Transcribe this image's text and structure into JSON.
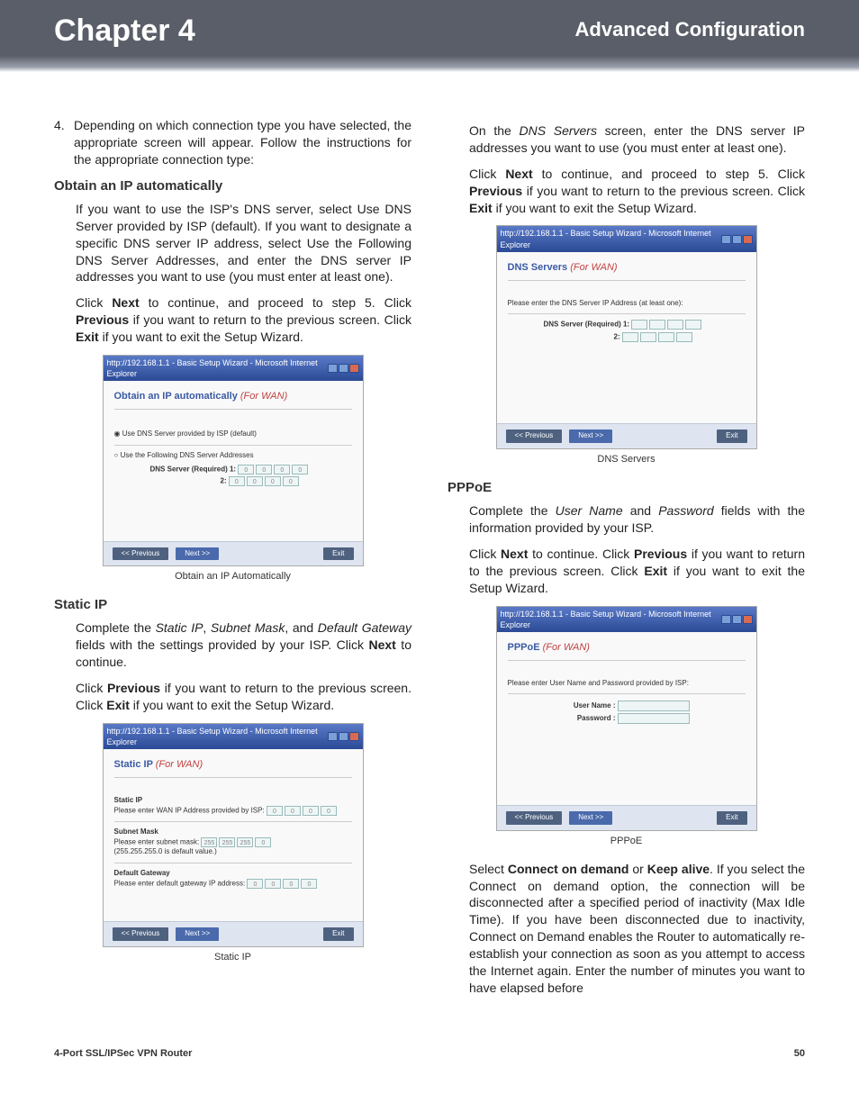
{
  "header": {
    "chapter": "Chapter 4",
    "section": "Advanced Configuration"
  },
  "footer": {
    "product": "4-Port SSL/IPSec VPN Router",
    "page": "50"
  },
  "left": {
    "step4_num": "4.",
    "step4": "Depending on which connection type you have selected, the appropriate screen will appear. Follow the instructions for the appropriate connection type:",
    "obtain_h": "Obtain an IP automatically",
    "obtain_p1": "If you want to use the ISP's DNS server, select Use DNS Server provided by ISP (default). If you want to designate a specific DNS server IP address, select Use the Following DNS Server Addresses, and enter the DNS server IP addresses you want to use (you must enter at least one).",
    "obtain_p2_a": "Click ",
    "obtain_p2_next": "Next",
    "obtain_p2_b": " to continue, and proceed to step 5. Click ",
    "obtain_p2_prev": "Previous",
    "obtain_p2_c": " if you want to return to the previous screen. Click ",
    "obtain_p2_exit": "Exit",
    "obtain_p2_d": " if you want to exit the Setup Wizard.",
    "shot1": {
      "title": "http://192.168.1.1 - Basic Setup Wizard - Microsoft Internet Explorer",
      "heading": "Obtain an IP automatically ",
      "heading_red": "(For WAN)",
      "opt1": "Use DNS Server provided by ISP (default)",
      "opt2": "Use the Following DNS Server Addresses",
      "dns_lbl": "DNS Server (Required) 1:",
      "dns_lbl2": "2:",
      "ip_ph": "0",
      "btn_prev": "<< Previous",
      "btn_next": "Next >>",
      "btn_exit": "Exit",
      "caption": "Obtain an IP Automatically"
    },
    "static_h": "Static IP",
    "static_p1_a": "Complete the ",
    "static_p1_i1": "Static IP",
    "static_p1_b": ", ",
    "static_p1_i2": "Subnet Mask",
    "static_p1_c": ", and ",
    "static_p1_i3": "Default Gateway",
    "static_p1_d": " fields with the settings provided by your ISP. Click ",
    "static_p1_next": "Next",
    "static_p1_e": " to continue.",
    "static_p2_a": "Click ",
    "static_p2_prev": "Previous",
    "static_p2_b": " if you want to return to the previous screen. Click ",
    "static_p2_exit": "Exit",
    "static_p2_c": " if you want to exit the Setup Wizard.",
    "shot2": {
      "title": "http://192.168.1.1 - Basic Setup Wizard - Microsoft Internet Explorer",
      "heading": "Static IP ",
      "heading_red": "(For WAN)",
      "sec1": "Static IP",
      "sec1_lbl": "Please enter WAN IP Address provided by ISP:",
      "sec2": "Subnet Mask",
      "sec2_lbl": "Please enter subnet mask:",
      "sec2_v": "255",
      "sec2_note": "(255.255.255.0 is default value.)",
      "sec3": "Default Gateway",
      "sec3_lbl": "Please enter default gateway IP address:",
      "ip_ph": "0",
      "btn_prev": "<< Previous",
      "btn_next": "Next >>",
      "btn_exit": "Exit",
      "caption": "Static IP"
    }
  },
  "right": {
    "dns_p1_a": "On the ",
    "dns_p1_i": "DNS Servers",
    "dns_p1_b": " screen, enter the DNS server IP addresses you want to use (you must enter at least one).",
    "dns_p2_a": "Click ",
    "dns_p2_next": "Next",
    "dns_p2_b": " to continue, and proceed to step 5. Click ",
    "dns_p2_prev": "Previous",
    "dns_p2_c": " if you want to return to the previous screen. Click ",
    "dns_p2_exit": "Exit",
    "dns_p2_d": " if you want to exit the Setup Wizard.",
    "shot3": {
      "title": "http://192.168.1.1 - Basic Setup Wizard - Microsoft Internet Explorer",
      "heading": "DNS Servers ",
      "heading_red": "(For WAN)",
      "note": "Please enter the DNS Server IP Address (at least one):",
      "dns_lbl": "DNS Server (Required) 1:",
      "dns_lbl2": "2:",
      "btn_prev": "<< Previous",
      "btn_next": "Next >>",
      "btn_exit": "Exit",
      "caption": "DNS Servers"
    },
    "pppoe_h": "PPPoE",
    "pppoe_p1_a": "Complete the ",
    "pppoe_p1_i1": "User Name",
    "pppoe_p1_b": " and ",
    "pppoe_p1_i2": "Password",
    "pppoe_p1_c": " fields with the information provided by your ISP.",
    "pppoe_p2_a": "Click ",
    "pppoe_p2_next": "Next",
    "pppoe_p2_b": " to continue. Click ",
    "pppoe_p2_prev": "Previous",
    "pppoe_p2_c": " if you want to return to the previous screen. Click ",
    "pppoe_p2_exit": "Exit",
    "pppoe_p2_d": " if you want to exit the Setup Wizard.",
    "shot4": {
      "title": "http://192.168.1.1 - Basic Setup Wizard - Microsoft Internet Explorer",
      "heading": "PPPoE ",
      "heading_red": "(For WAN)",
      "note": "Please enter User Name and Password provided by ISP:",
      "user_lbl": "User Name :",
      "pass_lbl": "Password :",
      "btn_prev": "<< Previous",
      "btn_next": "Next >>",
      "btn_exit": "Exit",
      "caption": "PPPoE"
    },
    "pppoe_p3_a": "Select ",
    "pppoe_p3_b1": "Connect on demand",
    "pppoe_p3_b": " or ",
    "pppoe_p3_b2": "Keep alive",
    "pppoe_p3_c": ". If you select the Connect on demand option, the connection will be disconnected after a specified period of inactivity (Max Idle Time). If you have been disconnected due to inactivity, Connect on Demand enables the Router to automatically re-establish your connection as soon as you attempt to access the Internet again. Enter the number of minutes you want to have elapsed before"
  }
}
